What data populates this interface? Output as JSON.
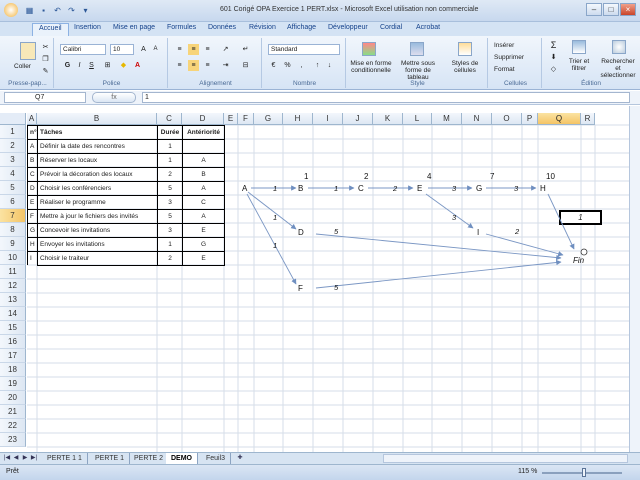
{
  "window": {
    "title": "601 Corigé OPA Exercice 1 PERT.xlsx - Microsoft Excel utilisation non commerciale"
  },
  "tabs": [
    "Accueil",
    "Insertion",
    "Mise en page",
    "Formules",
    "Données",
    "Révision",
    "Affichage",
    "Développeur",
    "Cordial",
    "Acrobat"
  ],
  "ribbon": {
    "paste": "Coller",
    "font_name": "Calibri",
    "font_size": "10",
    "number_format": "Standard",
    "groups": {
      "clipboard": "Presse-pap...",
      "font": "Police",
      "alignment": "Alignement",
      "number": "Nombre",
      "style": "Style",
      "cells": "Cellules",
      "edit": "Édition"
    },
    "style_buttons": [
      "Mise en forme conditionnelle",
      "Mettre sous forme de tableau",
      "Styles de cellules"
    ],
    "cells_buttons": [
      "Insérer",
      "Supprimer",
      "Format"
    ],
    "edit_buttons": [
      "Trier et filtrer",
      "Rechercher et sélectionner"
    ],
    "bold": "G",
    "italic": "I",
    "underline": "S",
    "fx": "fx"
  },
  "formula_bar": {
    "cell_ref": "Q7",
    "value": "1"
  },
  "columns": [
    "A",
    "B",
    "C",
    "D",
    "E",
    "F",
    "G",
    "H",
    "I",
    "J",
    "K",
    "L",
    "M",
    "N",
    "O",
    "P",
    "Q",
    "R"
  ],
  "rows": [
    "1",
    "2",
    "3",
    "4",
    "5",
    "6",
    "7",
    "8",
    "9",
    "10",
    "11",
    "12",
    "13",
    "14",
    "15",
    "16",
    "17",
    "18",
    "19",
    "20",
    "21",
    "22",
    "23"
  ],
  "table": {
    "headers": [
      "n°",
      "Tâches",
      "Durée",
      "Antériorité"
    ],
    "rows": [
      [
        "A",
        "Définir la date des rencontres",
        "1",
        ""
      ],
      [
        "B",
        "Réserver les locaux",
        "1",
        "A"
      ],
      [
        "C",
        "Prévoir la décoration des locaux",
        "2",
        "B"
      ],
      [
        "D",
        "Choisir les conférenciers",
        "5",
        "A"
      ],
      [
        "E",
        "Réaliser le programme",
        "3",
        "C"
      ],
      [
        "F",
        "Mettre à jour le fichiers des invités",
        "5",
        "A"
      ],
      [
        "G",
        "Concevoir les invitations",
        "3",
        "E"
      ],
      [
        "H",
        "Envoyer les invitations",
        "1",
        "G"
      ],
      [
        "I",
        "Choisir le traiteur",
        "2",
        "E"
      ]
    ]
  },
  "pert": {
    "nodes": {
      "A": "A",
      "B": "B",
      "C": "C",
      "E": "E",
      "G": "G",
      "H": "H",
      "D": "D",
      "I": "I",
      "F": "F",
      "Fin": "Fin"
    },
    "dates": {
      "B": "1",
      "C": "2",
      "E": "4",
      "G": "7",
      "H": "10"
    },
    "edges": {
      "AB": "1",
      "BC": "1",
      "CE": "2",
      "EG": "3",
      "GH": "3",
      "AD": "1",
      "AF": "1",
      "EI": "3",
      "DFin": "5",
      "IFin": "2",
      "FFin": "5"
    }
  },
  "selected_cell_value": "1",
  "sheet_tabs": [
    "PERTE 1 1",
    "PERTE 1",
    "PERTE 2",
    "DEMO",
    "Feuil3"
  ],
  "active_sheet": "DEMO",
  "status": {
    "ready": "Prêt",
    "zoom": "115 %"
  }
}
